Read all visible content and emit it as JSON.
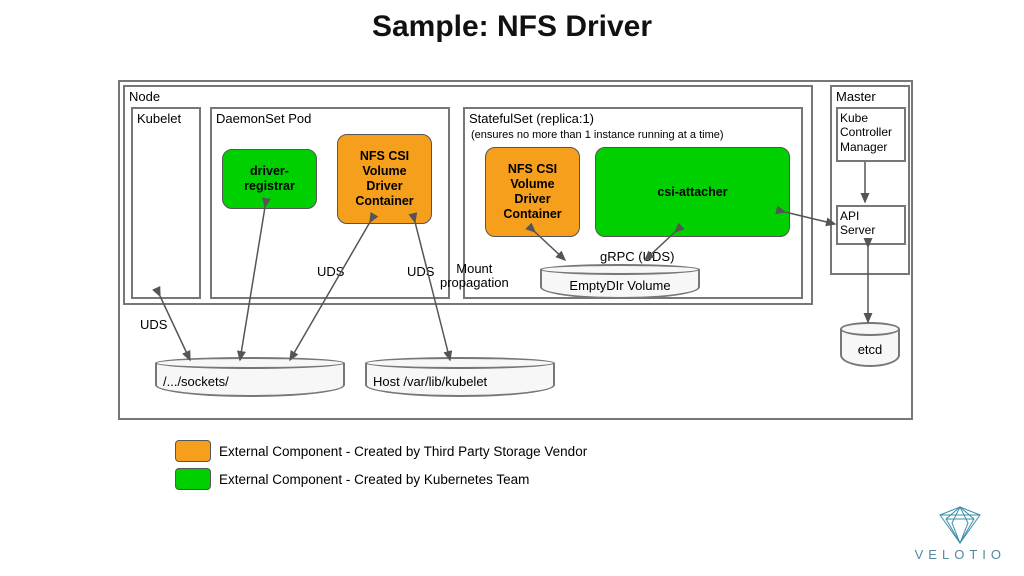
{
  "title": "Sample: NFS Driver",
  "node": {
    "label": "Node",
    "kubelet": "Kubelet",
    "daemonset": {
      "label": "DaemonSet Pod",
      "driver_registrar": "driver-\nregistrar",
      "nfs_csi": "NFS CSI\nVolume\nDriver\nContainer"
    },
    "statefulset": {
      "label": "StatefulSet (replica:1)",
      "note": "(ensures no more than 1 instance running at a time)",
      "nfs_csi": "NFS CSI\nVolume\nDriver\nContainer",
      "csi_attacher": "csi-attacher",
      "emptydir": "EmptyDIr Volume"
    }
  },
  "master": {
    "label": "Master",
    "kcm": "Kube\nController\nManager",
    "api": "API\nServer",
    "etcd": "etcd"
  },
  "connectors": {
    "uds1": "UDS",
    "uds2": "UDS",
    "uds3": "UDS",
    "mount_prop": "Mount\npropagation",
    "grpc": "gRPC (UDS)"
  },
  "cylinders": {
    "sockets": "/.../sockets/",
    "host_kubelet": "Host /var/lib/kubelet"
  },
  "legend": {
    "orange": "External Component - Created by Third Party Storage Vendor",
    "green": "External Component - Created by Kubernetes Team"
  },
  "brand": "VELOTIO"
}
